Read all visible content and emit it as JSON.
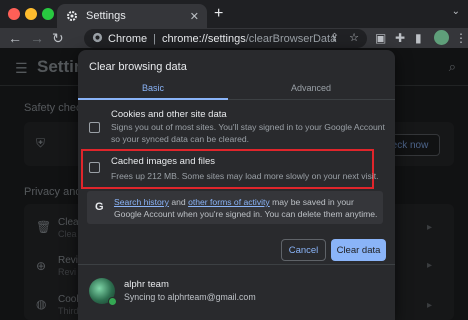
{
  "browser": {
    "tab_title": "Settings",
    "tab_close": "✕",
    "new_tab": "+",
    "site_chip": "Chrome",
    "url_host": "chrome://settings",
    "url_path": "/clearBrowserData"
  },
  "page": {
    "title": "Settings",
    "sections": {
      "safety_check": "Safety check",
      "privacy": "Privacy and s"
    },
    "check_now": "eck now",
    "rows": [
      {
        "title": "Clea",
        "sub": "Clea"
      },
      {
        "title": "Revi",
        "sub": "Revi"
      },
      {
        "title": "Cook",
        "sub": "Third"
      }
    ]
  },
  "dialog": {
    "title": "Clear browsing data",
    "tabs": {
      "basic": "Basic",
      "advanced": "Advanced"
    },
    "options": [
      {
        "title": "Cookies and other site data",
        "description": "Signs you out of most sites. You'll stay signed in to your Google Account so your synced data can be cleared.",
        "checked": false
      },
      {
        "title": "Cached images and files",
        "description": "Frees up 212 MB. Some sites may load more slowly on your next visit.",
        "checked": false
      }
    ],
    "info": {
      "link1": "Search history",
      "mid1": " and ",
      "link2": "other forms of activity",
      "rest": " may be saved in your Google Account when you're signed in. You can delete them anytime."
    },
    "buttons": {
      "cancel": "Cancel",
      "clear": "Clear data"
    },
    "account": {
      "name": "alphr team",
      "sync": "Syncing to alphrteam@gmail.com"
    }
  },
  "colors": {
    "accent": "#8ab4f8",
    "highlight": "#e0252b"
  }
}
